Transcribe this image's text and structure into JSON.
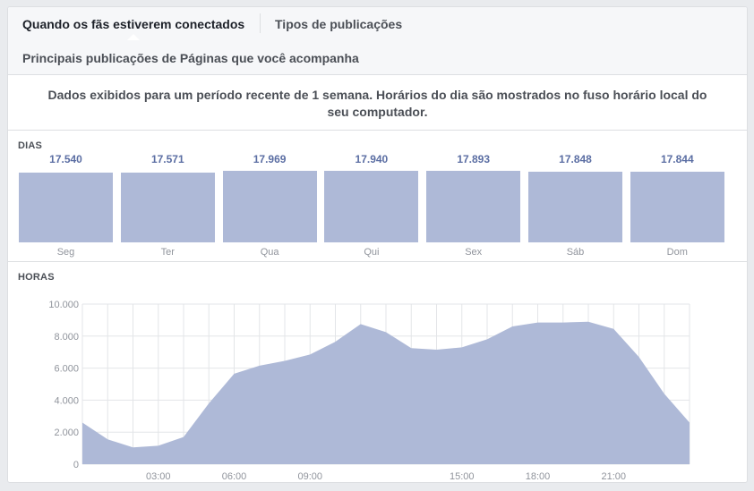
{
  "tabs": {
    "when_fans_online": "Quando os fãs estiverem conectados",
    "post_types": "Tipos de publicações",
    "top_posts": "Principais publicações de Páginas que você acompanha"
  },
  "notice": "Dados exibidos para um período recente de 1 semana. Horários do dia são mostrados no fuso horário local do seu computador.",
  "days": {
    "title": "DIAS",
    "items": [
      {
        "label": "Seg",
        "value": "17.540"
      },
      {
        "label": "Ter",
        "value": "17.571"
      },
      {
        "label": "Qua",
        "value": "17.969"
      },
      {
        "label": "Qui",
        "value": "17.940"
      },
      {
        "label": "Sex",
        "value": "17.893"
      },
      {
        "label": "Sáb",
        "value": "17.848"
      },
      {
        "label": "Dom",
        "value": "17.844"
      }
    ]
  },
  "hours": {
    "title": "HORAS"
  },
  "colors": {
    "bar_fill": "#aeb9d7",
    "area_fill": "#aeb9d7",
    "value_text": "#5b6ea3",
    "grid": "#e3e5e8"
  },
  "chart_data": [
    {
      "type": "bar",
      "title": "DIAS",
      "categories": [
        "Seg",
        "Ter",
        "Qua",
        "Qui",
        "Sex",
        "Sáb",
        "Dom"
      ],
      "values": [
        17540,
        17571,
        17969,
        17940,
        17893,
        17848,
        17844
      ],
      "data_labels": [
        "17.540",
        "17.571",
        "17.969",
        "17.940",
        "17.893",
        "17.848",
        "17.844"
      ],
      "ylim": [
        0,
        17969
      ],
      "grid": false
    },
    {
      "type": "area",
      "title": "HORAS",
      "x": [
        0,
        1,
        2,
        3,
        4,
        5,
        6,
        7,
        8,
        9,
        10,
        11,
        12,
        13,
        14,
        15,
        16,
        17,
        18,
        19,
        20,
        21,
        22,
        23,
        24
      ],
      "y": [
        2600,
        1550,
        1050,
        1150,
        1700,
        3800,
        5650,
        6150,
        6450,
        6850,
        7650,
        8750,
        8250,
        7250,
        7150,
        7300,
        7800,
        8600,
        8850,
        8850,
        8900,
        8450,
        6700,
        4400,
        2600
      ],
      "xticks": [
        3,
        6,
        9,
        15,
        18,
        21
      ],
      "xtick_labels": [
        "03:00",
        "06:00",
        "09:00",
        "15:00",
        "18:00",
        "21:00"
      ],
      "yticks": [
        0,
        2000,
        4000,
        6000,
        8000,
        10000
      ],
      "ytick_labels": [
        "0",
        "2.000",
        "4.000",
        "6.000",
        "8.000",
        "10.000"
      ],
      "xlim": [
        0,
        24
      ],
      "ylim": [
        0,
        10000
      ],
      "grid": true
    }
  ]
}
